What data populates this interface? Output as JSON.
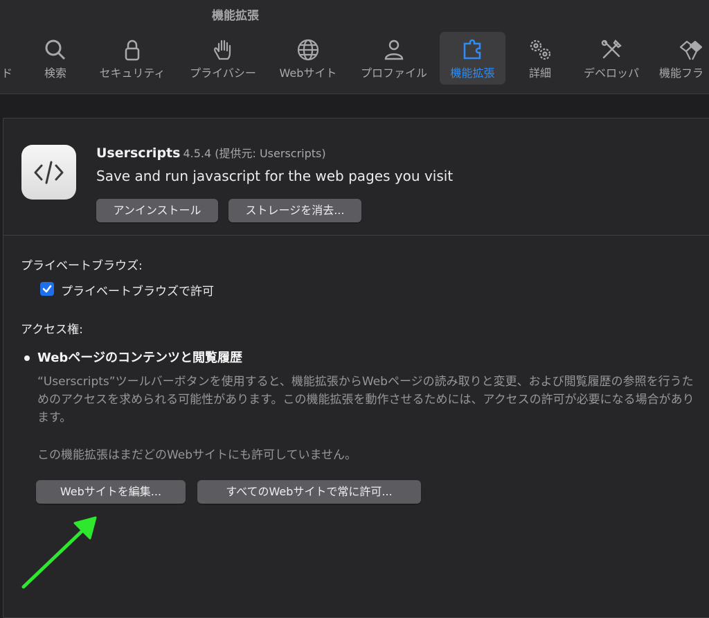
{
  "window": {
    "title": "機能拡張"
  },
  "toolbar": {
    "tabs": [
      {
        "label": "ド",
        "icon": "download-icon",
        "active": false
      },
      {
        "label": "検索",
        "icon": "search-icon",
        "active": false
      },
      {
        "label": "セキュリティ",
        "icon": "lock-icon",
        "active": false
      },
      {
        "label": "プライバシー",
        "icon": "hand-icon",
        "active": false
      },
      {
        "label": "Webサイト",
        "icon": "globe-icon",
        "active": false
      },
      {
        "label": "プロファイル",
        "icon": "person-icon",
        "active": false
      },
      {
        "label": "機能拡張",
        "icon": "puzzle-icon",
        "active": true
      },
      {
        "label": "詳細",
        "icon": "gears-icon",
        "active": false
      },
      {
        "label": "デベロッパ",
        "icon": "tools-icon",
        "active": false
      },
      {
        "label": "機能フラ",
        "icon": "flags-icon",
        "active": false
      }
    ]
  },
  "extension": {
    "name": "Userscripts",
    "meta": "4.5.4 (提供元: Userscripts)",
    "description": "Save and run javascript for the web pages you visit",
    "uninstall_label": "アンインストール",
    "clear_storage_label": "ストレージを消去..."
  },
  "private_browsing": {
    "heading": "プライベートブラウズ:",
    "checkbox_label": "プライベートブラウズで許可",
    "checked": true
  },
  "access": {
    "heading": "アクセス権:",
    "permission_title": "Webページのコンテンツと閲覧履歴",
    "permission_desc": "“Userscripts”ツールバーボタンを使用すると、機能拡張からWebページの読み取りと変更、および閲覧履歴の参照を行うためのアクセスを求められる可能性があります。この機能拡張を動作させるためには、アクセスの許可が必要になる場合があります。",
    "status": "この機能拡張はまだどのWebサイトにも許可していません。",
    "edit_websites_label": "Webサイトを編集...",
    "always_allow_label": "すべてのWebサイトで常に許可..."
  },
  "colors": {
    "accent": "#2f8cf2",
    "annotation_arrow": "#2ee82e",
    "background": "#1e1e20"
  }
}
